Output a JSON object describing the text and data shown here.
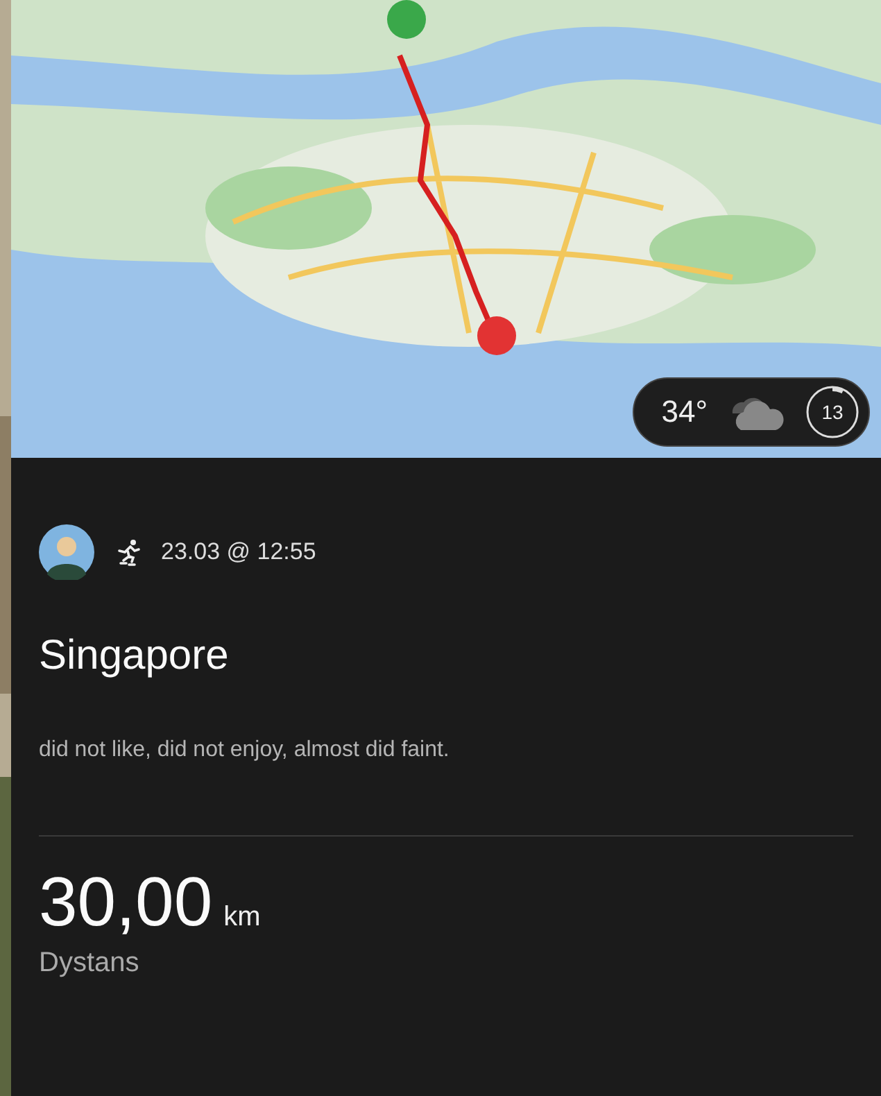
{
  "weather": {
    "temperature": "34°",
    "uv_index": "13"
  },
  "activity": {
    "date": "23.03 @ 12:55",
    "title": "Singapore",
    "description": "did not like, did not enjoy, almost did faint."
  },
  "stats": [
    {
      "value": "30,00",
      "unit": "km",
      "label": "Dystans"
    }
  ]
}
